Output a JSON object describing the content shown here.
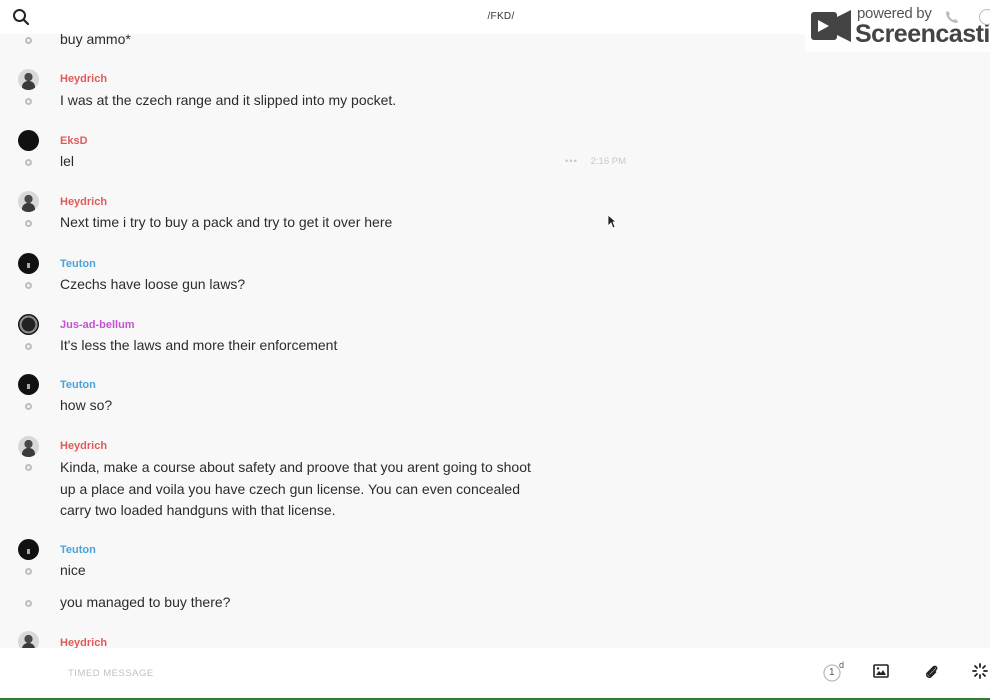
{
  "header": {
    "channel_title": "/FKD/",
    "search_icon": "search-icon"
  },
  "watermark": {
    "small_text": "powered by",
    "brand_text": "Screencastify"
  },
  "author_colors": {
    "Heydrich": "#e05a5a",
    "EksD": "#e05a5a",
    "Teuton": "#4aa3d8",
    "Jus-ad-bellum": "#c64fd6"
  },
  "messages": [
    {
      "text": "buy ammo*"
    },
    {
      "author": "Heydrich",
      "text": "I was at the czech range and it slipped into my pocket."
    },
    {
      "author": "EksD",
      "text": "lel",
      "meta_dots": "•••",
      "time": "2:16 PM"
    },
    {
      "author": "Heydrich",
      "text": "Next time i try to buy a pack and try to get it over here"
    },
    {
      "author": "Teuton",
      "text": "Czechs have loose gun laws?"
    },
    {
      "author": "Jus-ad-bellum",
      "text": "It's less the laws and more their enforcement"
    },
    {
      "author": "Teuton",
      "text": "how so?"
    },
    {
      "author": "Heydrich",
      "text": "Kinda, make a course about safety and proove that you arent going to shoot up a place and voila you have czech gun license. You can even concealed carry two loaded handguns with that license."
    },
    {
      "author": "Teuton",
      "text": "nice"
    },
    {
      "text": "you managed to buy there?"
    },
    {
      "author": "Heydrich",
      "text": ""
    }
  ],
  "composer": {
    "placeholder": "TIMED MESSAGE",
    "timer_value": "1",
    "timer_unit": "d",
    "icons": [
      "timer-icon",
      "image-icon",
      "paperclip-icon",
      "loading-spinner-icon"
    ]
  }
}
